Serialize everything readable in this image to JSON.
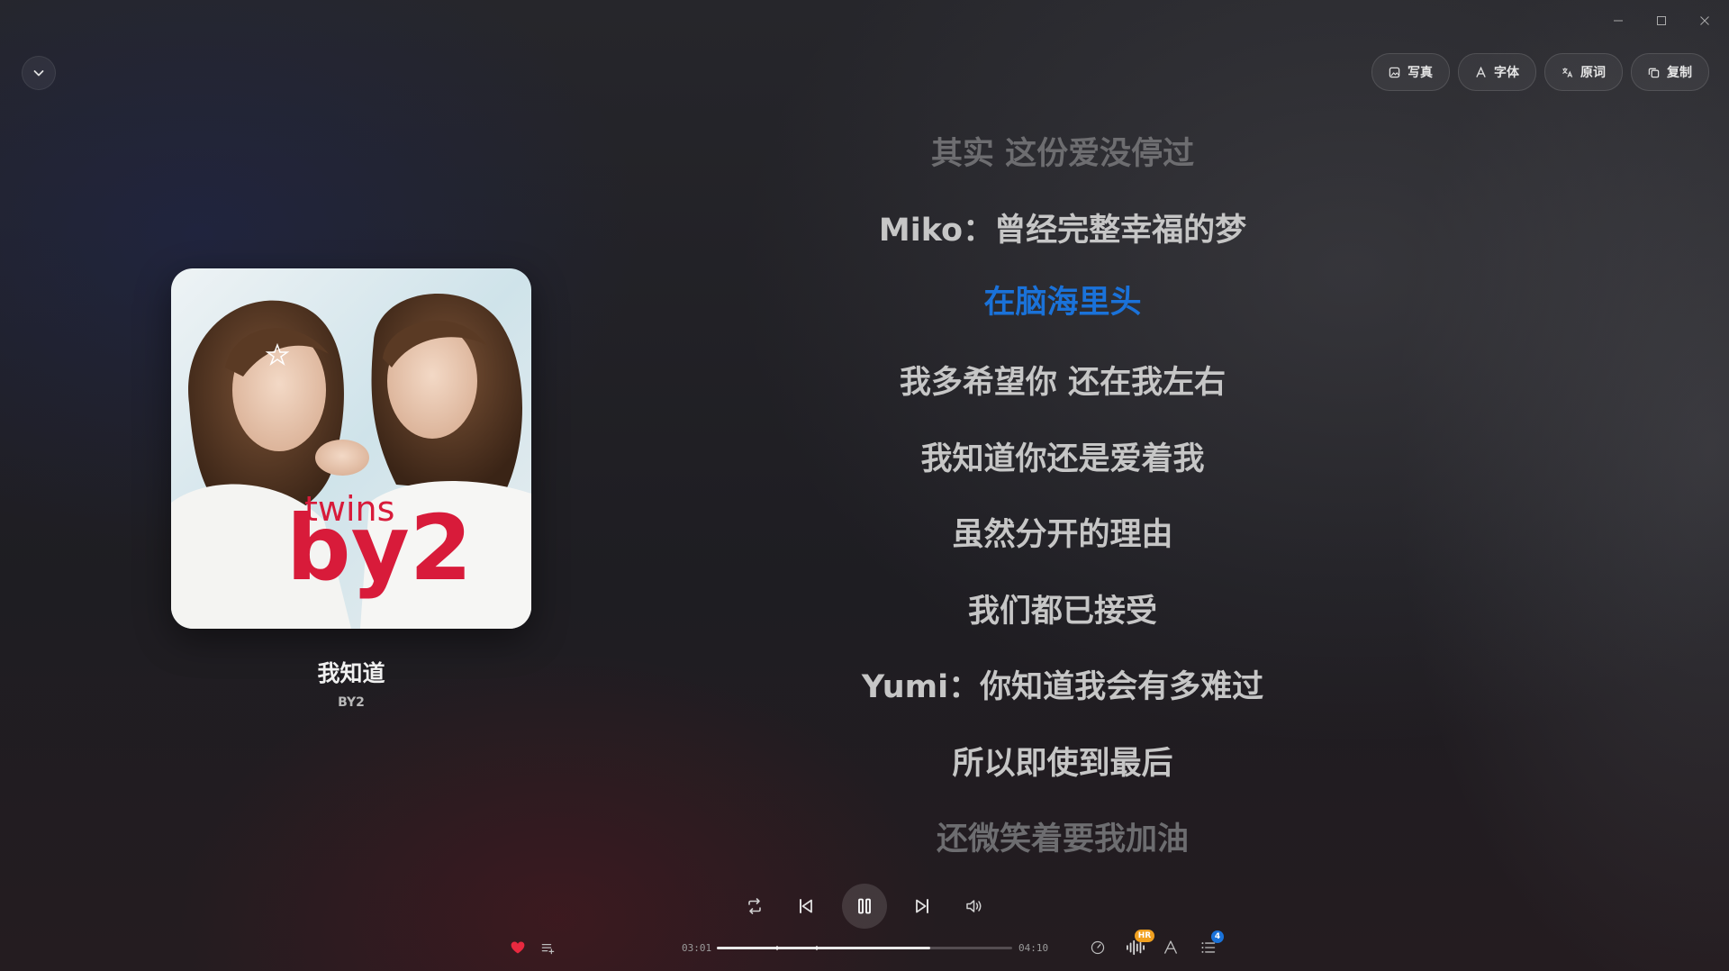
{
  "window": {
    "minimize_icon": "minimize-icon",
    "maximize_icon": "maximize-icon",
    "close_icon": "close-icon"
  },
  "toolbar": {
    "photo_label": "写真",
    "font_label": "字体",
    "original_label": "原词",
    "copy_label": "复制"
  },
  "song": {
    "title": "我知道",
    "artist": "BY2",
    "cover_text_small": "twins",
    "cover_text_large": "by2"
  },
  "lyrics": {
    "lines": [
      "其实 这份爱没停过",
      "Miko：曾经完整幸福的梦",
      "在脑海里头",
      "我多希望你 还在我左右",
      "我知道你还是爱着我",
      "虽然分开的理由",
      "我们都已接受",
      "Yumi：你知道我会有多难过",
      "所以即使到最后",
      "还微笑着要我加油"
    ],
    "active_index": 2
  },
  "player": {
    "current_time": "03:01",
    "total_time": "04:10",
    "progress_fraction": 0.724,
    "hr_badge": "HR",
    "queue_count": "4",
    "accent_color": "#1a72d9",
    "liked": true
  }
}
